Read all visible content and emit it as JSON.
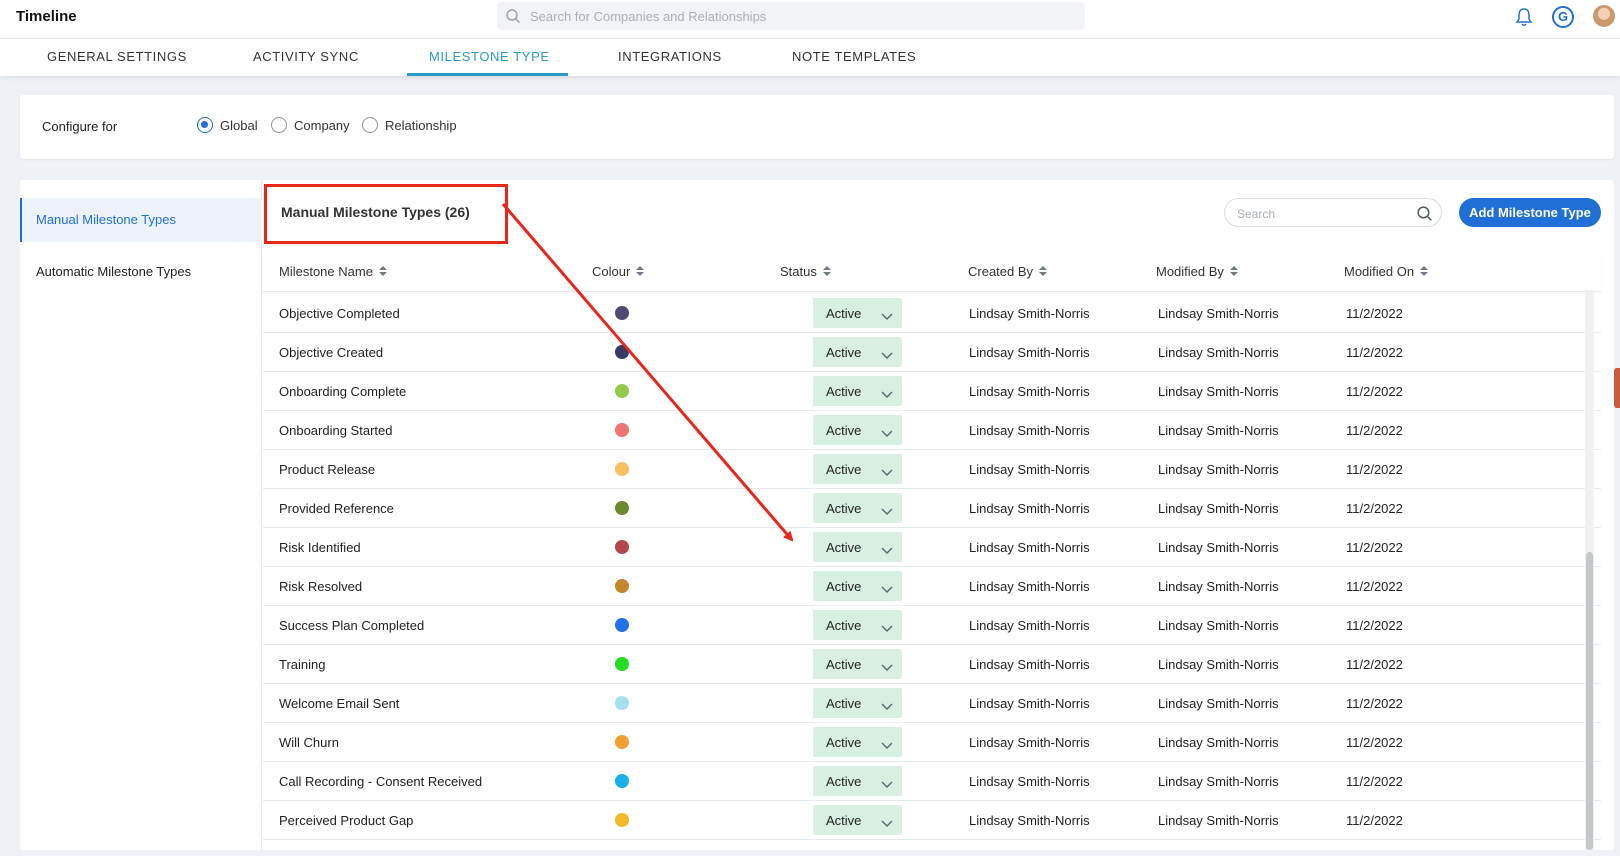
{
  "app": {
    "title": "Timeline"
  },
  "header": {
    "search_placeholder": "Search for Companies and Relationships",
    "logo_letter": "G"
  },
  "tabs": [
    {
      "label": "GENERAL SETTINGS"
    },
    {
      "label": "ACTIVITY SYNC"
    },
    {
      "label": "MILESTONE TYPE",
      "active": true
    },
    {
      "label": "INTEGRATIONS"
    },
    {
      "label": "NOTE TEMPLATES"
    }
  ],
  "configure": {
    "label": "Configure for",
    "options": [
      {
        "label": "Global",
        "checked": true
      },
      {
        "label": "Company",
        "checked": false
      },
      {
        "label": "Relationship",
        "checked": false
      }
    ]
  },
  "sidebar": {
    "items": [
      {
        "label": "Manual Milestone Types",
        "active": true
      },
      {
        "label": "Automatic Milestone Types",
        "active": false
      }
    ]
  },
  "section": {
    "title": "Manual Milestone Types (26)",
    "search_placeholder": "Search",
    "add_button": "Add Milestone Type"
  },
  "table": {
    "columns": [
      "Milestone Name",
      "Colour",
      "Status",
      "Created By",
      "Modified By",
      "Modified On"
    ],
    "rows": [
      {
        "name": "Objective Completed",
        "colour": "#4f4a72",
        "status": "Active",
        "created_by": "Lindsay Smith-Norris",
        "modified_by": "Lindsay Smith-Norris",
        "modified_on": "11/2/2022"
      },
      {
        "name": "Objective Created",
        "colour": "#393a64",
        "status": "Active",
        "created_by": "Lindsay Smith-Norris",
        "modified_by": "Lindsay Smith-Norris",
        "modified_on": "11/2/2022"
      },
      {
        "name": "Onboarding Complete",
        "colour": "#93c94f",
        "status": "Active",
        "created_by": "Lindsay Smith-Norris",
        "modified_by": "Lindsay Smith-Norris",
        "modified_on": "11/2/2022"
      },
      {
        "name": "Onboarding Started",
        "colour": "#f07474",
        "status": "Active",
        "created_by": "Lindsay Smith-Norris",
        "modified_by": "Lindsay Smith-Norris",
        "modified_on": "11/2/2022"
      },
      {
        "name": "Product Release",
        "colour": "#f7c062",
        "status": "Active",
        "created_by": "Lindsay Smith-Norris",
        "modified_by": "Lindsay Smith-Norris",
        "modified_on": "11/2/2022"
      },
      {
        "name": "Provided Reference",
        "colour": "#6a8a2c",
        "status": "Active",
        "created_by": "Lindsay Smith-Norris",
        "modified_by": "Lindsay Smith-Norris",
        "modified_on": "11/2/2022"
      },
      {
        "name": "Risk Identified",
        "colour": "#b44747",
        "status": "Active",
        "created_by": "Lindsay Smith-Norris",
        "modified_by": "Lindsay Smith-Norris",
        "modified_on": "11/2/2022"
      },
      {
        "name": "Risk Resolved",
        "colour": "#c4862e",
        "status": "Active",
        "created_by": "Lindsay Smith-Norris",
        "modified_by": "Lindsay Smith-Norris",
        "modified_on": "11/2/2022"
      },
      {
        "name": "Success Plan Completed",
        "colour": "#2470e8",
        "status": "Active",
        "created_by": "Lindsay Smith-Norris",
        "modified_by": "Lindsay Smith-Norris",
        "modified_on": "11/2/2022"
      },
      {
        "name": "Training",
        "colour": "#22dd22",
        "status": "Active",
        "created_by": "Lindsay Smith-Norris",
        "modified_by": "Lindsay Smith-Norris",
        "modified_on": "11/2/2022"
      },
      {
        "name": "Welcome Email Sent",
        "colour": "#a6e0ef",
        "status": "Active",
        "created_by": "Lindsay Smith-Norris",
        "modified_by": "Lindsay Smith-Norris",
        "modified_on": "11/2/2022"
      },
      {
        "name": "Will Churn",
        "colour": "#f0a030",
        "status": "Active",
        "created_by": "Lindsay Smith-Norris",
        "modified_by": "Lindsay Smith-Norris",
        "modified_on": "11/2/2022"
      },
      {
        "name": "Call Recording - Consent Received",
        "colour": "#1aaee6",
        "status": "Active",
        "created_by": "Lindsay Smith-Norris",
        "modified_by": "Lindsay Smith-Norris",
        "modified_on": "11/2/2022"
      },
      {
        "name": "Perceived Product Gap",
        "colour": "#f5b82a",
        "status": "Active",
        "created_by": "Lindsay Smith-Norris",
        "modified_by": "Lindsay Smith-Norris",
        "modified_on": "11/2/2022"
      }
    ]
  },
  "annotation": {
    "color": "#e8261a"
  }
}
